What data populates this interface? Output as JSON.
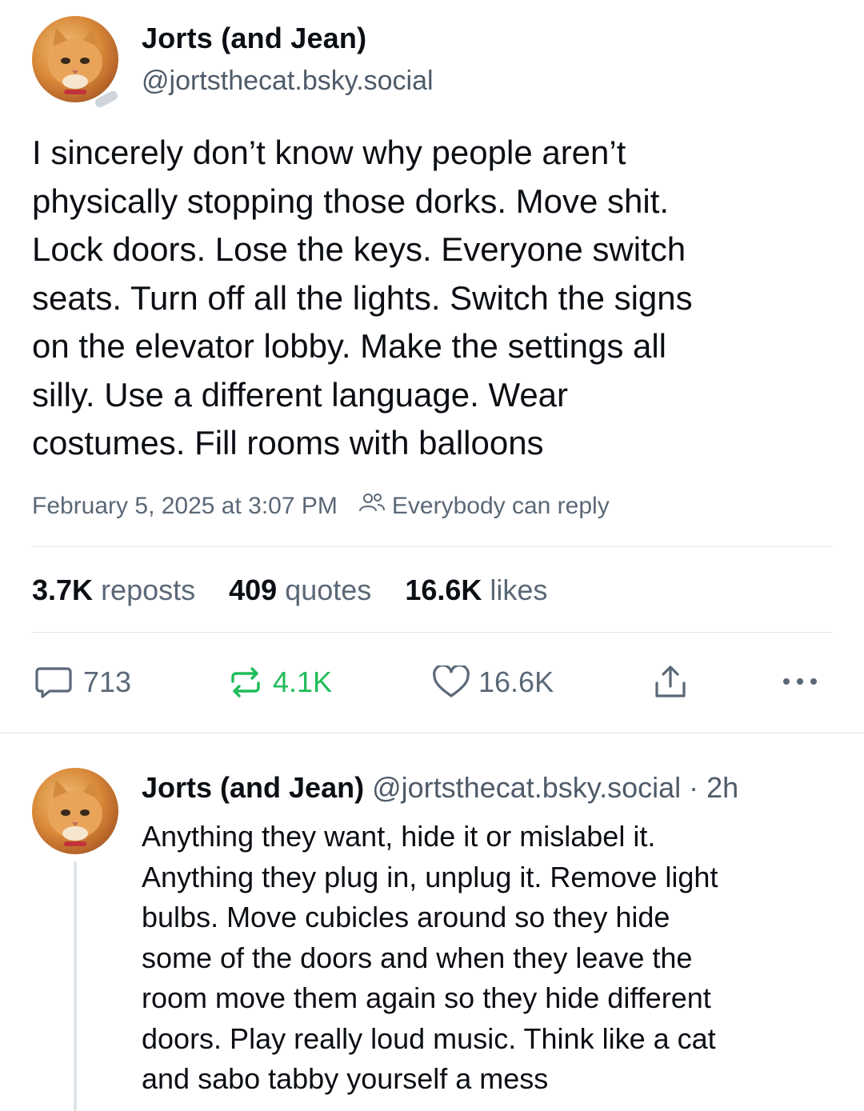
{
  "post": {
    "author_name": "Jorts (and Jean)",
    "author_handle": "@jortsthecat.bsky.social",
    "text_lines": [
      "I sincerely don’t know why people aren’t",
      "physically stopping those dorks. Move shit.",
      "Lock doors. Lose the keys. Everyone switch",
      "seats. Turn off all the lights. Switch the signs",
      "on the elevator lobby. Make the settings all",
      "silly. Use a different language. Wear",
      "costumes. Fill rooms with balloons"
    ],
    "timestamp": "February 5, 2025 at 3:07 PM",
    "reply_setting": "Everybody can reply",
    "reply_setting_icon": "people-icon",
    "stats": {
      "reposts_count": "3.7K",
      "reposts_label": "reposts",
      "quotes_count": "409",
      "quotes_label": "quotes",
      "likes_count": "16.6K",
      "likes_label": "likes"
    },
    "actions": {
      "reply_count": "713",
      "repost_count": "4.1K",
      "like_count": "16.6K"
    },
    "colors": {
      "repost_active": "#20bc5a",
      "secondary_text": "#5b6877"
    }
  },
  "reply": {
    "author_name": "Jorts (and Jean)",
    "author_handle": "@jortsthecat.bsky.social",
    "separator": "·",
    "age": "2h",
    "text_lines": [
      "Anything they want, hide it or mislabel it.",
      "Anything they plug in, unplug it. Remove light",
      "bulbs. Move cubicles around so they hide",
      "some of the doors and when they leave the",
      "room move them again so they hide different",
      "doors. Play really loud music. Think like a cat",
      "and sabo tabby yourself a mess"
    ]
  }
}
